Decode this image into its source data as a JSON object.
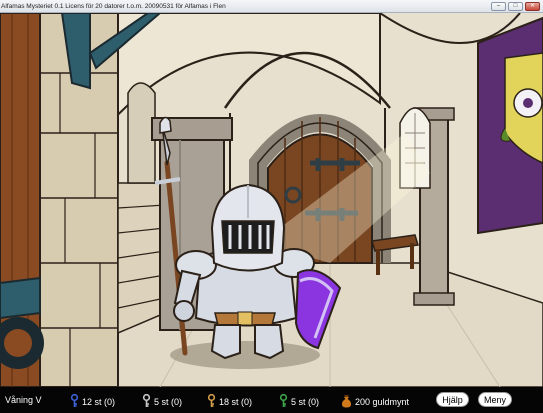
{
  "window": {
    "title": "Alfamas Mysteriet 0.1   Licens för 20 datorer t.o.m. 20090531 för Alfamas i Flen",
    "buttons": {
      "minimize": "–",
      "maximize": "□",
      "close": "✕"
    }
  },
  "status": {
    "floor": "Våning V",
    "keys": [
      {
        "color": "#3f63d8",
        "icon": "blue-key-icon",
        "label": "12 st (0)"
      },
      {
        "color": "#c9c9c9",
        "icon": "silver-key-icon",
        "label": "5 st (0)"
      },
      {
        "color": "#d5a04a",
        "icon": "gold-key-icon",
        "label": "18 st (0)"
      },
      {
        "color": "#3fa64a",
        "icon": "green-key-icon",
        "label": "5 st (0)"
      }
    ],
    "coins": {
      "icon": "money-bag-icon",
      "color": "#d07a1c",
      "label": "200 guldmynt"
    },
    "help_label": "Hjälp",
    "menu_label": "Meny"
  },
  "scene": {
    "name": "castle-hall",
    "character": "knight"
  }
}
